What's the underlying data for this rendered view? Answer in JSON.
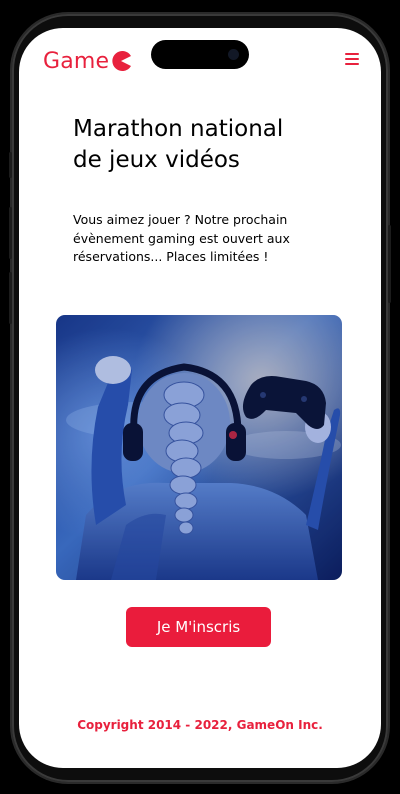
{
  "header": {
    "logo_text": "Game",
    "menu_icon": "hamburger-menu-icon"
  },
  "main": {
    "title": "Marathon national de jeux vidéos",
    "description": "Vous aimez jouer ? Notre prochain évènement gaming est ouvert aux réservations... Places limitées !",
    "cta_label": "Je M'inscris"
  },
  "footer": {
    "copyright": "Copyright 2014 - 2022, GameOn Inc."
  },
  "colors": {
    "brand": "#e8213d",
    "button": "#ea1c3c",
    "background": "#ffffff"
  }
}
